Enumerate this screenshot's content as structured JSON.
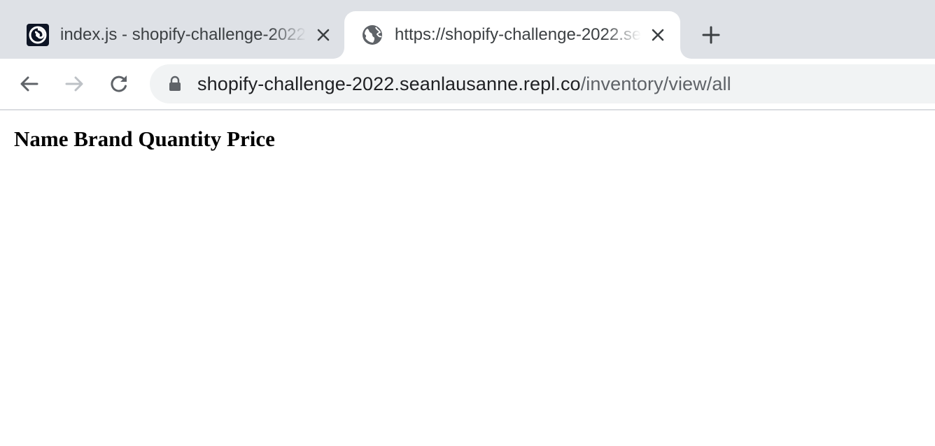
{
  "tabs": [
    {
      "title": "index.js - shopify-challenge-2022 - Replit",
      "favicon": "replit-logo-icon",
      "active": false
    },
    {
      "title": "https://shopify-challenge-2022.seanlausanne.repl.co/inventory/view/all",
      "favicon": "globe-icon",
      "active": true
    }
  ],
  "toolbar": {
    "url_host": "shopify-challenge-2022.seanlausanne.repl.co",
    "url_path": "/inventory/view/all"
  },
  "page": {
    "columns": [
      "Name",
      "Brand",
      "Quantity",
      "Price"
    ]
  },
  "colors": {
    "tabstrip_bg": "#dee1e6",
    "omnibox_bg": "#f1f3f4",
    "text_primary": "#202124",
    "text_secondary": "#5f6368"
  }
}
